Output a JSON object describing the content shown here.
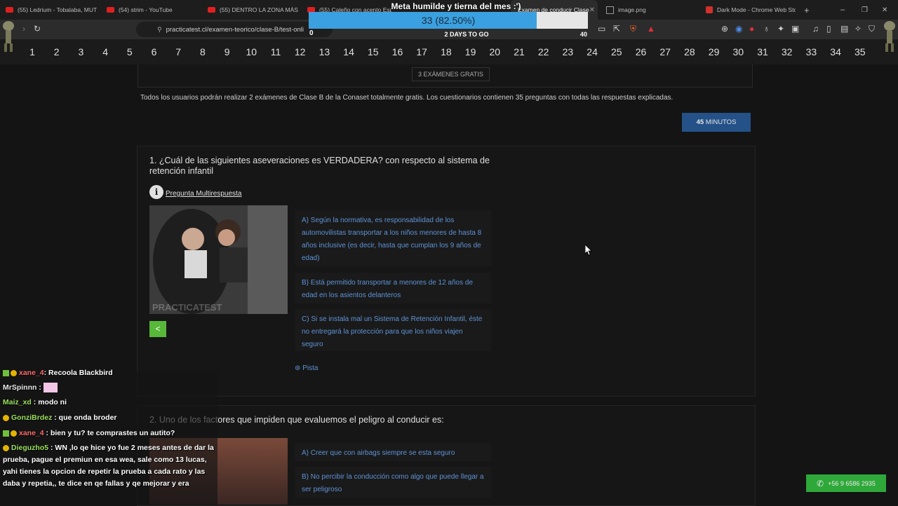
{
  "browser": {
    "tabs": [
      {
        "title": "(55) Ledrium - Tobalaba, MUT",
        "kind": "youtube"
      },
      {
        "title": "(54) strim - YouTube",
        "kind": "youtube"
      },
      {
        "title": "(55) DENTRO LA ZONA MÁS T",
        "kind": "youtube"
      },
      {
        "title": "(55) Caleño con acento Espa",
        "kind": "youtube"
      },
      {
        "title": "Examen de conducir Clase",
        "kind": "active"
      },
      {
        "title": "image.png",
        "kind": "doc"
      },
      {
        "title": "Dark Mode - Chrome Web Sto",
        "kind": "webstore"
      }
    ],
    "new_tab_label": "+",
    "url": "practicatest.cl/examen-teorico/clase-B/test-onli"
  },
  "question_nav": {
    "numbers": [
      "1",
      "2",
      "3",
      "4",
      "5",
      "6",
      "7",
      "8",
      "9",
      "10",
      "11",
      "12",
      "13",
      "14",
      "15",
      "16",
      "17",
      "18",
      "19",
      "20",
      "21",
      "22",
      "23",
      "24",
      "25",
      "26",
      "27",
      "28",
      "29",
      "30",
      "31",
      "32",
      "33",
      "34",
      "35"
    ]
  },
  "goal_overlay": {
    "title": "Meta humilde y tierna del mes :')",
    "progress_text": "33 (82.50%)",
    "progress_fraction": 0.825,
    "start": "0",
    "end": "40",
    "days": "2 DAYS TO GO",
    "fill_color": "#3aa0df"
  },
  "page": {
    "banner_button": "3 EXÁMENES GRATIS",
    "intro": "Todos los usuarios podrán realizar 2 exámenes de Clase B de la Conaset totalmente gratis. Los cuestionarios contienen 35 preguntas con todas las respuestas explicadas.",
    "timer_number": "45",
    "timer_unit": "MINUTOS",
    "q1": {
      "title": "1. ¿Cuál de las siguientes aseveraciones es VERDADERA? con respecto al sistema de retención infantil",
      "multi_label": "Pregunta Multirespuesta",
      "image_watermark": "PRACTICATEST",
      "options": [
        "A) Según la normativa, es responsabilidad de los automovilistas transportar a los niños menores de hasta 8 años inclusive (es decir, hasta que cumplan los 9 años de edad)",
        "B) Está permitido transportar a menores de 12 años de edad en los asientos delanteros",
        "C) Si se instala mal un Sistema de Retención Infantil, éste no entregará la protección para que los niños viajen seguro"
      ],
      "hint": "Pista"
    },
    "q2": {
      "title": "2. Uno de los factores que impiden que evaluemos el peligro al conducir es:",
      "options": [
        "A) Creer que con airbags siempre se esta seguro",
        "B) No percibir la conducción como algo que puede llegar a ser peligroso"
      ]
    },
    "whatsapp": "+56 9 6586 2935"
  },
  "chat": [
    {
      "user": "xane_4",
      "msg": ": Recoola Blackbird",
      "color": "#ff6b6b"
    },
    {
      "user": "MrSpinnn",
      "msg": " :",
      "color": "#e8e8e8"
    },
    {
      "user": "Maiz_xd",
      "msg": " : modo ni",
      "color": "#9be15d"
    },
    {
      "user": "GonziBrdez",
      "msg": " : que onda broder",
      "color": "#9be15d"
    },
    {
      "user": "xane_4",
      "msg": " : bien y tu? te comprastes un autito?",
      "color": "#ff6b6b"
    },
    {
      "user": "Dieguzho5",
      "msg": " : WN ,lo qe hice yo fue 2 meses antes de dar la prueba, pague el premiun en esa wea, sale como 13 lucas, yahi tienes la opcion de repetir la prueba a cada rato y las daba y repetia,, te dice en qe fallas y qe mejorar y era",
      "color": "#9be15d"
    }
  ]
}
